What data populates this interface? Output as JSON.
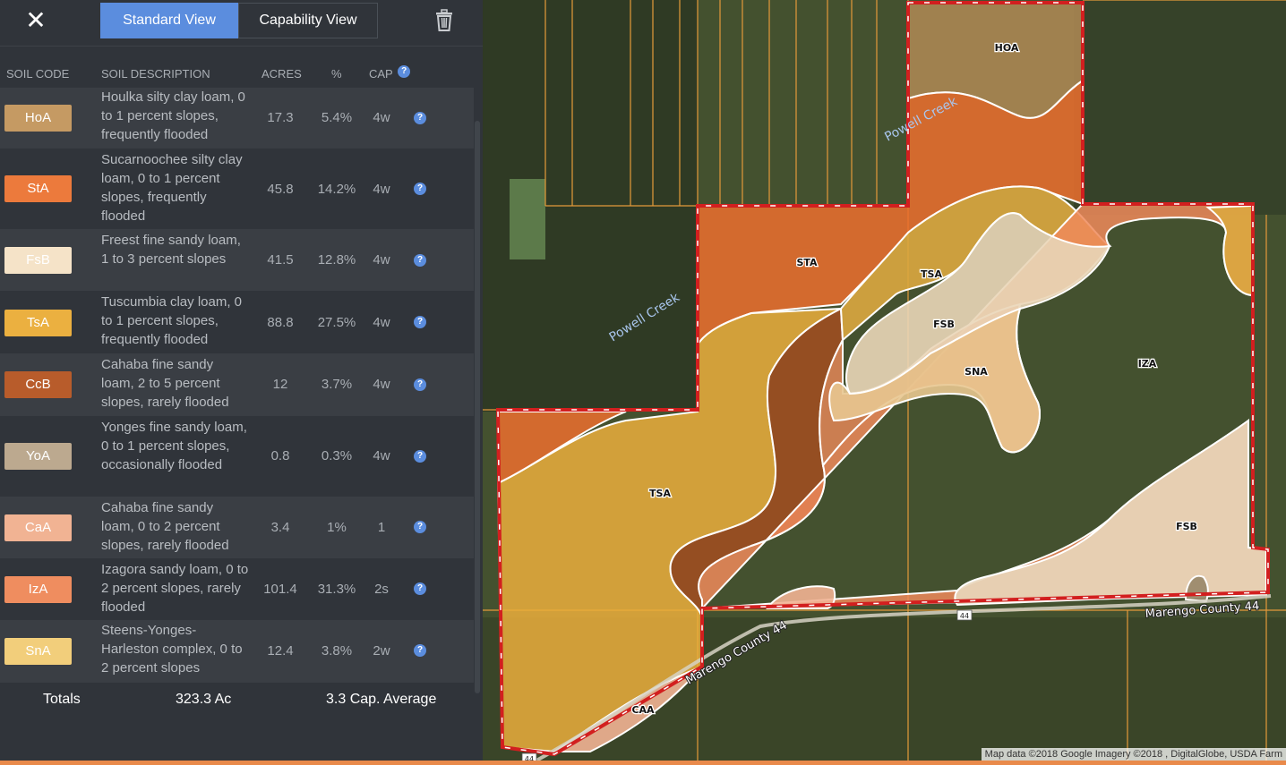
{
  "toolbar": {
    "close_label": "✕",
    "standard_view_label": "Standard View",
    "capability_view_label": "Capability View",
    "active_view": "standard"
  },
  "table": {
    "headers": {
      "code": "SOIL CODE",
      "description": "SOIL DESCRIPTION",
      "acres": "ACRES",
      "percent": "%",
      "cap": "CAP"
    },
    "rows": [
      {
        "code": "HoA",
        "color": "#c59a63",
        "description": "Houlka silty clay loam, 0 to 1 percent slopes, frequently flooded",
        "acres": "17.3",
        "percent": "5.4%",
        "cap": "4w"
      },
      {
        "code": "StA",
        "color": "#ec7a3c",
        "description": "Sucarnoochee silty clay loam, 0 to 1 percent slopes, frequently flooded",
        "acres": "45.8",
        "percent": "14.2%",
        "cap": "4w"
      },
      {
        "code": "FsB",
        "color": "#f5e3c8",
        "description": "Freest fine sandy loam, 1 to 3 percent slopes",
        "acres": "41.5",
        "percent": "12.8%",
        "cap": "4w"
      },
      {
        "code": "TsA",
        "color": "#ebb040",
        "description": "Tuscumbia clay loam, 0 to 1 percent slopes, frequently flooded",
        "acres": "88.8",
        "percent": "27.5%",
        "cap": "4w"
      },
      {
        "code": "CcB",
        "color": "#b85c2b",
        "description": "Cahaba fine sandy loam, 2 to 5 percent slopes, rarely flooded",
        "acres": "12",
        "percent": "3.7%",
        "cap": "4w"
      },
      {
        "code": "YoA",
        "color": "#bca98f",
        "description": "Yonges fine sandy loam, 0 to 1 percent slopes, occasionally flooded",
        "acres": "0.8",
        "percent": "0.3%",
        "cap": "4w"
      },
      {
        "code": "CaA",
        "color": "#f1b393",
        "description": "Cahaba fine sandy loam, 0 to 2 percent slopes, rarely flooded",
        "acres": "3.4",
        "percent": "1%",
        "cap": "1"
      },
      {
        "code": "IzA",
        "color": "#ef8d5f",
        "description": "Izagora sandy loam, 0 to 2 percent slopes, rarely flooded",
        "acres": "101.4",
        "percent": "31.3%",
        "cap": "2s"
      },
      {
        "code": "SnA",
        "color": "#f2ce7b",
        "description": "Steens-Yonges-Harleston complex, 0 to 2 percent slopes",
        "acres": "12.4",
        "percent": "3.8%",
        "cap": "2w"
      }
    ]
  },
  "totals": {
    "label": "Totals",
    "acres": "323.3 Ac",
    "cap_average": "3.3 Cap. Average"
  },
  "map": {
    "labels": {
      "hoa": "HOA",
      "sta": "STA",
      "tsa_north": "TSA",
      "fsb_north": "FSB",
      "sna": "SNA",
      "iza": "IZA",
      "tsa_south": "TSA",
      "fsb_south": "FSB",
      "caa": "CAA"
    },
    "road_label_1": "Marengo County 44",
    "road_label_2": "Marengo County 44",
    "road_shield_1": "44",
    "road_shield_2": "44",
    "creek_label_1": "Powell Creek",
    "creek_label_2": "Powell Creek",
    "attribution": "Map data ©2018 Google Imagery ©2018 , DigitalGlobe, USDA Farm"
  },
  "colors": {
    "accent": "#5b8dde",
    "boundary": "#d21f1f"
  }
}
